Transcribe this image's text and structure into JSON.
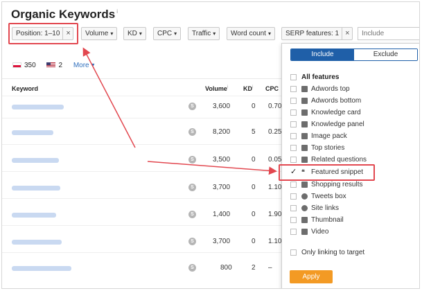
{
  "title": "Organic Keywords",
  "title_info": "i",
  "filters": {
    "position": "Position: 1–10",
    "volume": "Volume",
    "kd": "KD",
    "cpc": "CPC",
    "traffic": "Traffic",
    "word_count": "Word count",
    "serp_features": "SERP features: 1",
    "include_placeholder": "Include",
    "caret": "▾",
    "remove": "×"
  },
  "countries": [
    {
      "flag": "poland-flag-icon",
      "value": "350"
    },
    {
      "flag": "usa-flag-icon",
      "value": "2"
    }
  ],
  "more_label": "More ▾",
  "table": {
    "headers": {
      "keyword": "Keyword",
      "volume": "Volume",
      "kd": "KD",
      "cpc": "CPC"
    },
    "rows": [
      {
        "volume": "3,600",
        "kd": "0",
        "cpc": "0.70"
      },
      {
        "volume": "8,200",
        "kd": "5",
        "cpc": "0.25"
      },
      {
        "volume": "3,500",
        "kd": "0",
        "cpc": "0.05"
      },
      {
        "volume": "3,700",
        "kd": "0",
        "cpc": "1.10"
      },
      {
        "volume": "1,400",
        "kd": "0",
        "cpc": "1.90"
      },
      {
        "volume": "3,700",
        "kd": "0",
        "cpc": "1.10"
      },
      {
        "volume": "800",
        "kd": "2",
        "cpc": "–"
      }
    ],
    "serp_badge": "S"
  },
  "panel": {
    "include_label": "Include",
    "exclude_label": "Exclude",
    "all_features": "All features",
    "features": [
      {
        "label": "Adwords top",
        "icon": "adwords-top-icon"
      },
      {
        "label": "Adwords bottom",
        "icon": "adwords-bottom-icon"
      },
      {
        "label": "Knowledge card",
        "icon": "knowledge-card-icon"
      },
      {
        "label": "Knowledge panel",
        "icon": "knowledge-panel-icon"
      },
      {
        "label": "Image pack",
        "icon": "image-pack-icon"
      },
      {
        "label": "Top stories",
        "icon": "top-stories-icon"
      },
      {
        "label": "Related questions",
        "icon": "related-questions-icon"
      },
      {
        "label": "Featured snippet",
        "icon": "featured-snippet-icon",
        "checked": true
      },
      {
        "label": "Shopping results",
        "icon": "shopping-cart-icon"
      },
      {
        "label": "Tweets box",
        "icon": "twitter-icon"
      },
      {
        "label": "Site links",
        "icon": "link-icon"
      },
      {
        "label": "Thumbnail",
        "icon": "thumbnail-icon"
      },
      {
        "label": "Video",
        "icon": "video-icon"
      }
    ],
    "only_linking": "Only linking to target",
    "apply_label": "Apply"
  },
  "colors": {
    "accent": "#1f5fa8",
    "apply": "#f39a24",
    "highlight": "#e2474f"
  }
}
